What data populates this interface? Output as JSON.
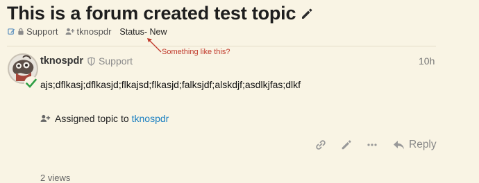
{
  "topic": {
    "title": "This is a forum created test topic",
    "category": "Support",
    "assigned_to": "tknospdr",
    "status_text": "Status- New"
  },
  "annotation": {
    "text": "Something like this?",
    "color": "#c0392b"
  },
  "post": {
    "username": "tknospdr",
    "category": "Support",
    "age": "10h",
    "body": "ajs;dflkasj;dflkasjd;flkajsd;flkasjd;falksjdf;alskdjf;asdlkjfas;dlkf"
  },
  "small_action": {
    "text": "Assigned topic to",
    "user": "tknospdr"
  },
  "actions": {
    "reply_label": "Reply"
  },
  "footer": {
    "views_text": "2 views"
  },
  "icons": {
    "title_edit": "pencil-icon",
    "meta_edit": "pencil-square-icon",
    "lock": "lock-icon",
    "assign": "user-plus-icon",
    "shield": "shield-icon",
    "link": "link-icon",
    "edit": "pencil-icon",
    "more": "ellipsis-icon",
    "reply": "reply-icon",
    "check": "check-icon"
  },
  "colors": {
    "background": "#f9f4e4",
    "link": "#1a7fc1",
    "annotation": "#c0392b",
    "check": "#2e9e44"
  }
}
